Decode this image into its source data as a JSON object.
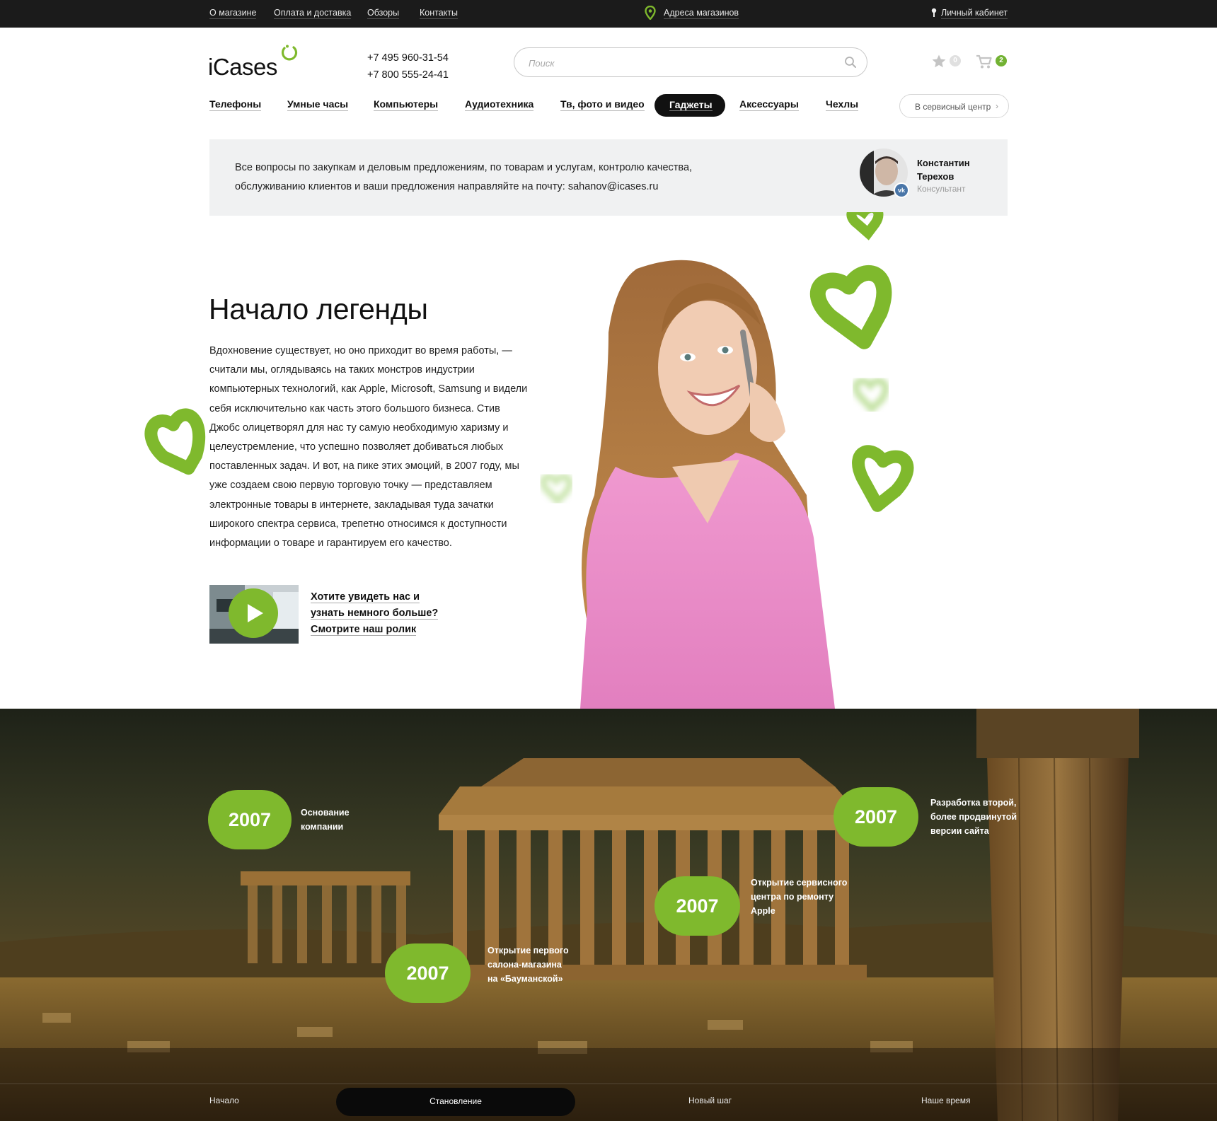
{
  "topbar": {
    "links": [
      "О магазине",
      "Оплата и доставка",
      "Обзоры",
      "Контакты"
    ],
    "stores_label": "Адреса магазинов",
    "account_label": "Личный кабинет"
  },
  "header": {
    "logo_text": "iCases",
    "phones": [
      "+7 495 960-31-54",
      "+7 800 555-24-41"
    ],
    "search_placeholder": "Поиск",
    "favorites_count": "0",
    "cart_count": "2"
  },
  "nav": {
    "items": [
      "Телефоны",
      "Умные часы",
      "Компьютеры",
      "Аудиотехника",
      "Тв, фото и видео",
      "Гаджеты",
      "Аксессуары",
      "Чехлы"
    ],
    "active": "Гаджеты",
    "service_button": "В сервисный центр"
  },
  "contact": {
    "text": "Все вопросы по закупкам и деловым предложениям, по товарам и услугам, контролю качества, обслуживанию клиентов и ваши предложения направляйте на почту: sahanov@icases.ru",
    "name": "Константин Терехов",
    "role": "Консультант"
  },
  "hero": {
    "title": "Начало легенды",
    "text": "Вдохновение существует, но оно приходит во время работы, — считали мы, оглядываясь на таких монстров индустрии компьютерных технологий, как Apple, Microsoft, Samsung и видели себя исключительно как часть этого большого бизнеса. Стив Джобс олицетворял для нас ту самую необходимую харизму и целеустремление, что успешно позволяет добиваться любых поставленных задач. И вот, на пике этих эмоций, в 2007 году, мы уже создаем свою первую торговую точку — представляем электронные товары в интернете, закладывая туда зачатки широкого спектра сервиса, трепетно относимся к доступности информации о товаре и гарантируем его качество.",
    "video_cta": [
      "Хотите увидеть нас и",
      "узнать немного больше?",
      "Смотрите наш ролик"
    ]
  },
  "milestones": [
    {
      "year": "2007",
      "text": [
        "Основание",
        "компании"
      ]
    },
    {
      "year": "2007",
      "text": [
        "Разработка второй,",
        "более продвинутой",
        "версии сайта"
      ]
    },
    {
      "year": "2007",
      "text": [
        "Открытие сервисного",
        "центра по ремонту",
        "Apple"
      ]
    },
    {
      "year": "2007",
      "text": [
        "Открытие первого",
        "салона-магазина",
        "на «Бауманской»"
      ]
    }
  ],
  "timeline": {
    "items": [
      "Начало",
      "Становление",
      "Новый шаг",
      "Наше время"
    ],
    "active": "Становление"
  },
  "colors": {
    "accent": "#7fb92d",
    "topbar_bg": "#1b1b1b",
    "infobar_bg": "#f0f1f2"
  }
}
